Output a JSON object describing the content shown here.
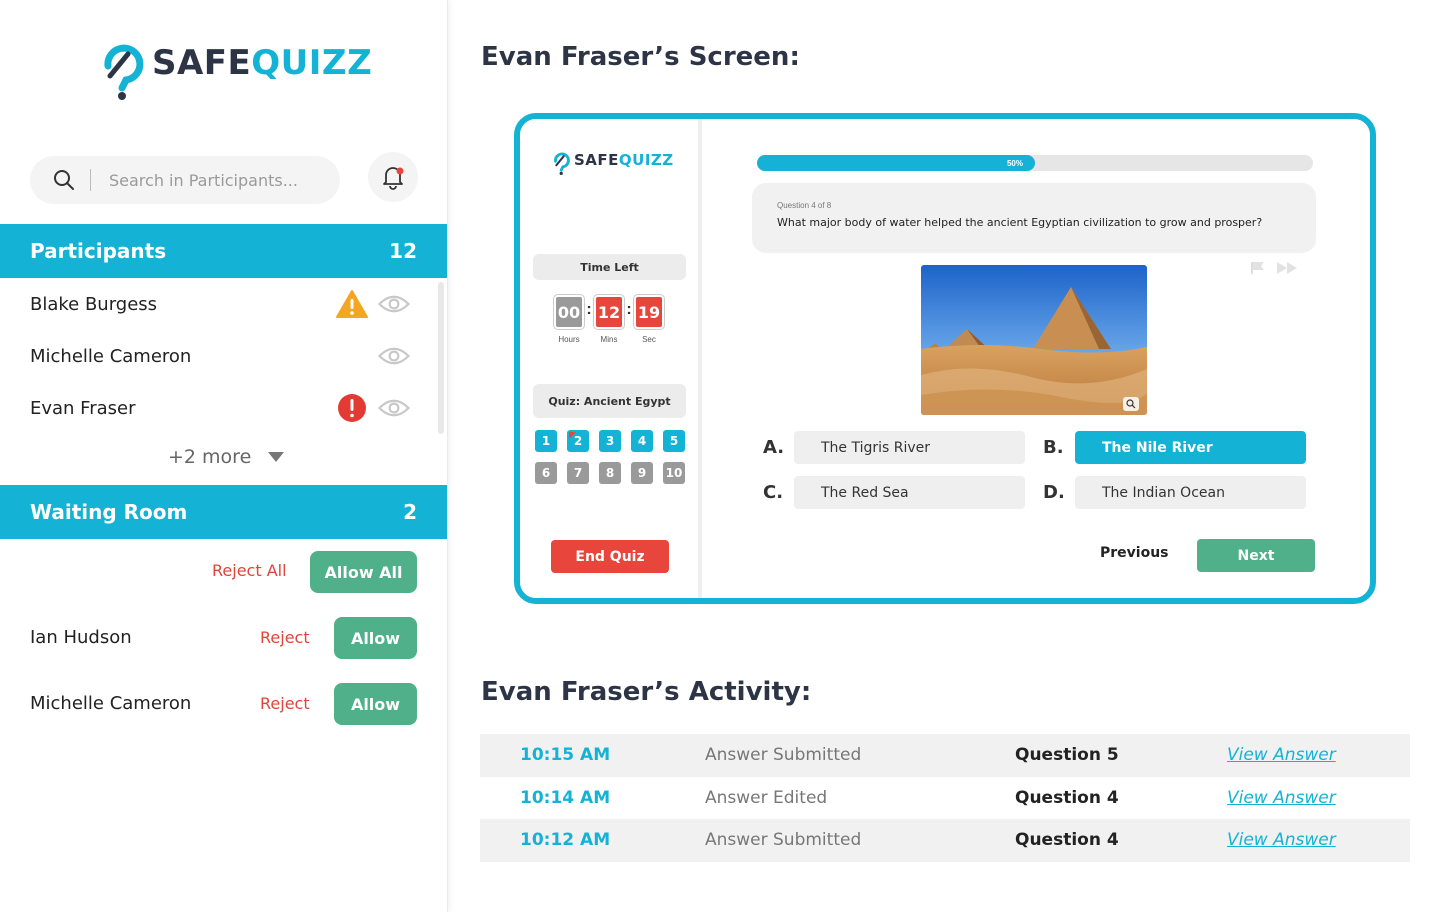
{
  "brand": {
    "part1": "SAFE",
    "part2": "QUIZZ",
    "primary_color": "#14b3d6",
    "dark_color": "#2d3446"
  },
  "search": {
    "placeholder": "Search in Participants..."
  },
  "participants": {
    "title": "Participants",
    "count": "12",
    "items": [
      {
        "name": "Blake Burgess",
        "status_icon": "warning-icon"
      },
      {
        "name": "Michelle Cameron",
        "status_icon": ""
      },
      {
        "name": "Evan Fraser",
        "status_icon": "alert-icon"
      }
    ],
    "more_label": "+2 more"
  },
  "waiting_room": {
    "title": "Waiting Room",
    "count": "2",
    "reject_all_label": "Reject All",
    "allow_all_label": "Allow All",
    "items": [
      {
        "name": "Ian Hudson",
        "reject_label": "Reject",
        "allow_label": "Allow"
      },
      {
        "name": "Michelle Cameron",
        "reject_label": "Reject",
        "allow_label": "Allow"
      }
    ]
  },
  "screen": {
    "title": "Evan Fraser’s Screen:",
    "time_left_label": "Time Left",
    "timer": {
      "hours": "00",
      "mins": "12",
      "sec": "19",
      "hours_label": "Hours",
      "mins_label": "Mins",
      "sec_label": "Sec"
    },
    "quiz_label": "Quiz: Ancient Egypt",
    "question_numbers": [
      "1",
      "2",
      "3",
      "4",
      "5",
      "6",
      "7",
      "8",
      "9",
      "10"
    ],
    "answered_count": 5,
    "flagged_question": 2,
    "end_quiz_label": "End Quiz",
    "progress_percent": 50,
    "progress_label": "50%",
    "question_meta": "Question 4 of 8",
    "question_text": "What major body of water helped the ancient Egyptian civilization to grow and prosper?",
    "options": [
      {
        "letter": "A.",
        "text": "The Tigris River"
      },
      {
        "letter": "B.",
        "text": "The Nile River",
        "selected": true
      },
      {
        "letter": "C.",
        "text": "The Red Sea"
      },
      {
        "letter": "D.",
        "text": "The Indian Ocean"
      }
    ],
    "previous_label": "Previous",
    "next_label": "Next"
  },
  "activity": {
    "title": "Evan Fraser’s Activity:",
    "rows": [
      {
        "time": "10:15 AM",
        "action": "Answer Submitted",
        "question": "Question 5",
        "link": "View Answer"
      },
      {
        "time": "10:14 AM",
        "action": "Answer Edited",
        "question": "Question 4",
        "link": "View Answer"
      },
      {
        "time": "10:12 AM",
        "action": "Answer Submitted",
        "question": "Question 4",
        "link": "View Answer"
      }
    ]
  }
}
